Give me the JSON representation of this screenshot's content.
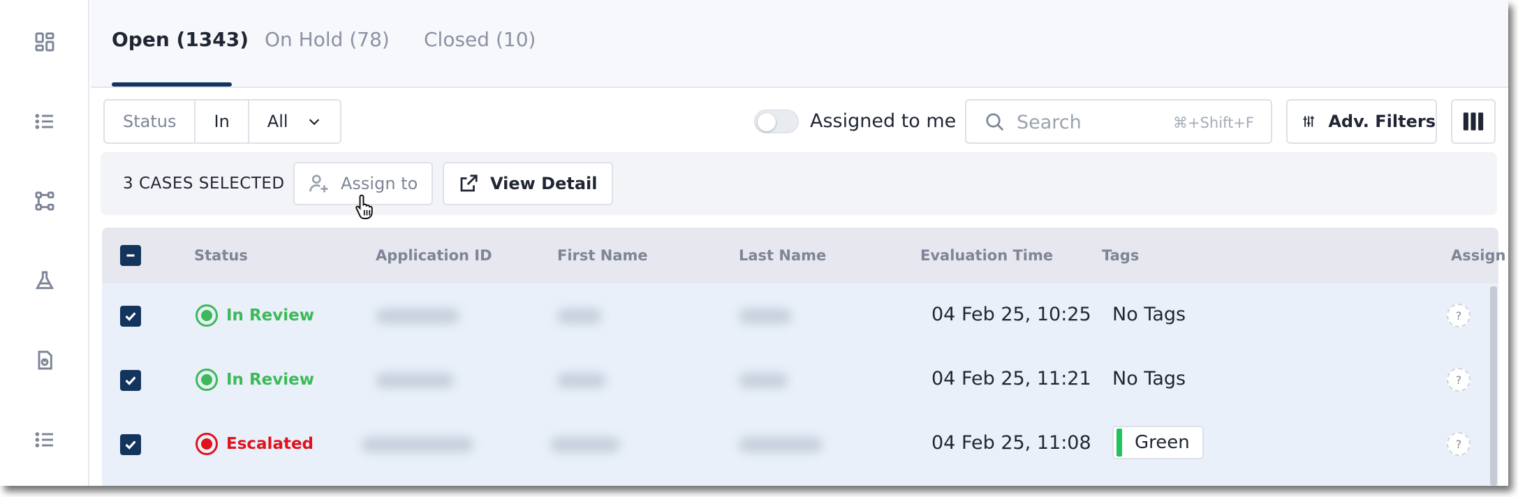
{
  "tabs": [
    {
      "label": "Open (1343)"
    },
    {
      "label": "On Hold (78)"
    },
    {
      "label": "Closed (10)"
    }
  ],
  "filters": {
    "status_label": "Status",
    "operator": "In",
    "value": "All",
    "assigned_to_me_label": "Assigned to me",
    "assigned_to_me_on": false,
    "search_placeholder": "Search",
    "search_shortcut": "⌘+Shift+F",
    "adv_filters_label": "Adv. Filters"
  },
  "selection": {
    "count_label": "3 CASES SELECTED",
    "assign_label": "Assign to",
    "view_detail_label": "View Detail"
  },
  "table": {
    "columns": [
      "Status",
      "Application ID",
      "First Name",
      "Last Name",
      "Evaluation Time",
      "Tags",
      "Assign"
    ],
    "rows": [
      {
        "selected": true,
        "status": "In Review",
        "status_color": "#3cba57",
        "evaluation_time": "04 Feb 25, 10:25",
        "tags": "No Tags",
        "tag_chip": null,
        "assignee": "?"
      },
      {
        "selected": true,
        "status": "In Review",
        "status_color": "#3cba57",
        "evaluation_time": "04 Feb 25, 11:21",
        "tags": "No Tags",
        "tag_chip": null,
        "assignee": "?"
      },
      {
        "selected": true,
        "status": "Escalated",
        "status_color": "#e0121c",
        "evaluation_time": "04 Feb 25, 11:08",
        "tags": null,
        "tag_chip": {
          "label": "Green",
          "color": "#20c35b"
        },
        "assignee": "?"
      }
    ]
  },
  "colors": {
    "accent": "#13345c",
    "in_review": "#3cba57",
    "escalated": "#e0121c",
    "tag_green": "#20c35b"
  }
}
